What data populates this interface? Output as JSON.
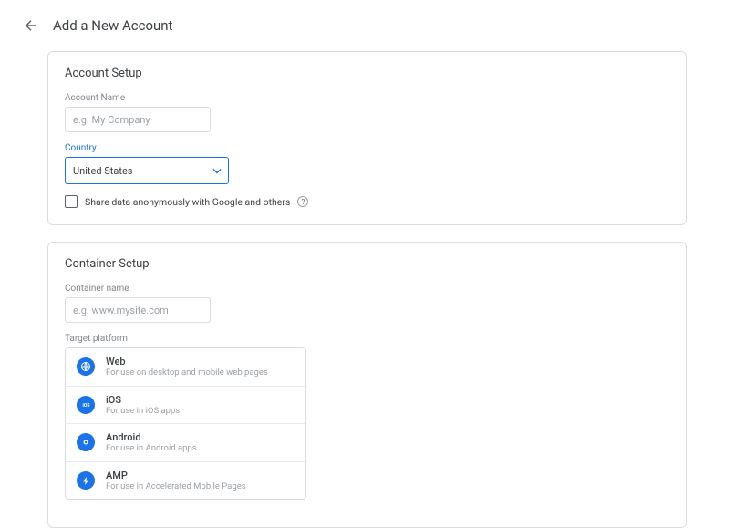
{
  "header": {
    "title": "Add a New Account"
  },
  "account_setup": {
    "title": "Account Setup",
    "account_name": {
      "label": "Account Name",
      "placeholder": "e.g. My Company",
      "value": ""
    },
    "country": {
      "label": "Country",
      "value": "United States"
    },
    "share_data": {
      "label": "Share data anonymously with Google and others",
      "checked": false
    }
  },
  "container_setup": {
    "title": "Container Setup",
    "container_name": {
      "label": "Container name",
      "placeholder": "e.g. www.mysite.com",
      "value": ""
    },
    "target_platform": {
      "label": "Target platform",
      "options": [
        {
          "name": "Web",
          "desc": "For use on desktop and mobile web pages",
          "icon": "web"
        },
        {
          "name": "iOS",
          "desc": "For use in iOS apps",
          "icon": "ios"
        },
        {
          "name": "Android",
          "desc": "For use in Android apps",
          "icon": "android"
        },
        {
          "name": "AMP",
          "desc": "For use in Accelerated Mobile Pages",
          "icon": "amp"
        }
      ]
    }
  }
}
